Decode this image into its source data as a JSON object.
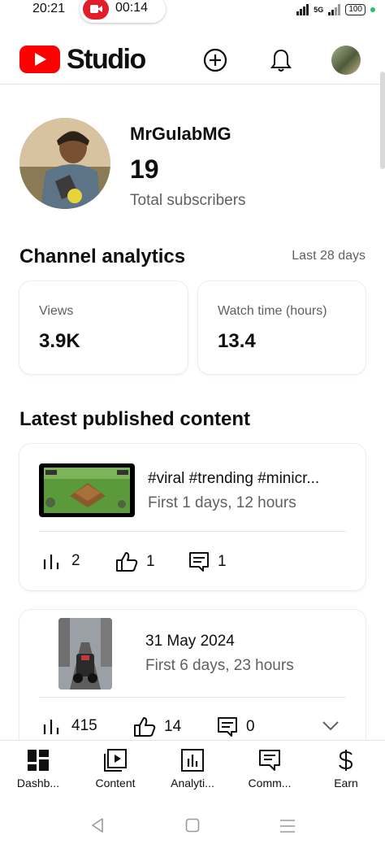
{
  "status_bar": {
    "time": "20:21",
    "recording_time": "00:14",
    "network_label": "5G",
    "battery": "100"
  },
  "header": {
    "brand": "Studio",
    "icons": [
      "create-icon",
      "notifications-icon",
      "account-avatar"
    ]
  },
  "channel": {
    "name": "MrGulabMG",
    "subscriber_count": "19",
    "subscriber_label": "Total subscribers"
  },
  "analytics": {
    "title": "Channel analytics",
    "period": "Last 28 days",
    "views_label": "Views",
    "views_value": "3.9K",
    "watch_label": "Watch time (hours)",
    "watch_value": "13.4"
  },
  "latest": {
    "title": "Latest published content",
    "items": [
      {
        "title": "#viral #trending #minicr...",
        "subtitle": "First 1 days, 12 hours",
        "views": "2",
        "likes": "1",
        "comments": "1"
      },
      {
        "title": "31 May 2024",
        "subtitle": "First 6 days, 23 hours",
        "views": "415",
        "likes": "14",
        "comments": "0"
      }
    ]
  },
  "bottom_nav": [
    {
      "label": "Dashb...",
      "icon": "dashboard-icon"
    },
    {
      "label": "Content",
      "icon": "content-icon"
    },
    {
      "label": "Analyti...",
      "icon": "analytics-icon"
    },
    {
      "label": "Comm...",
      "icon": "comments-icon"
    },
    {
      "label": "Earn",
      "icon": "dollar-icon"
    }
  ],
  "colors": {
    "brand_red": "#ff0000",
    "text": "#0f0f0f",
    "secondary": "#606060"
  }
}
